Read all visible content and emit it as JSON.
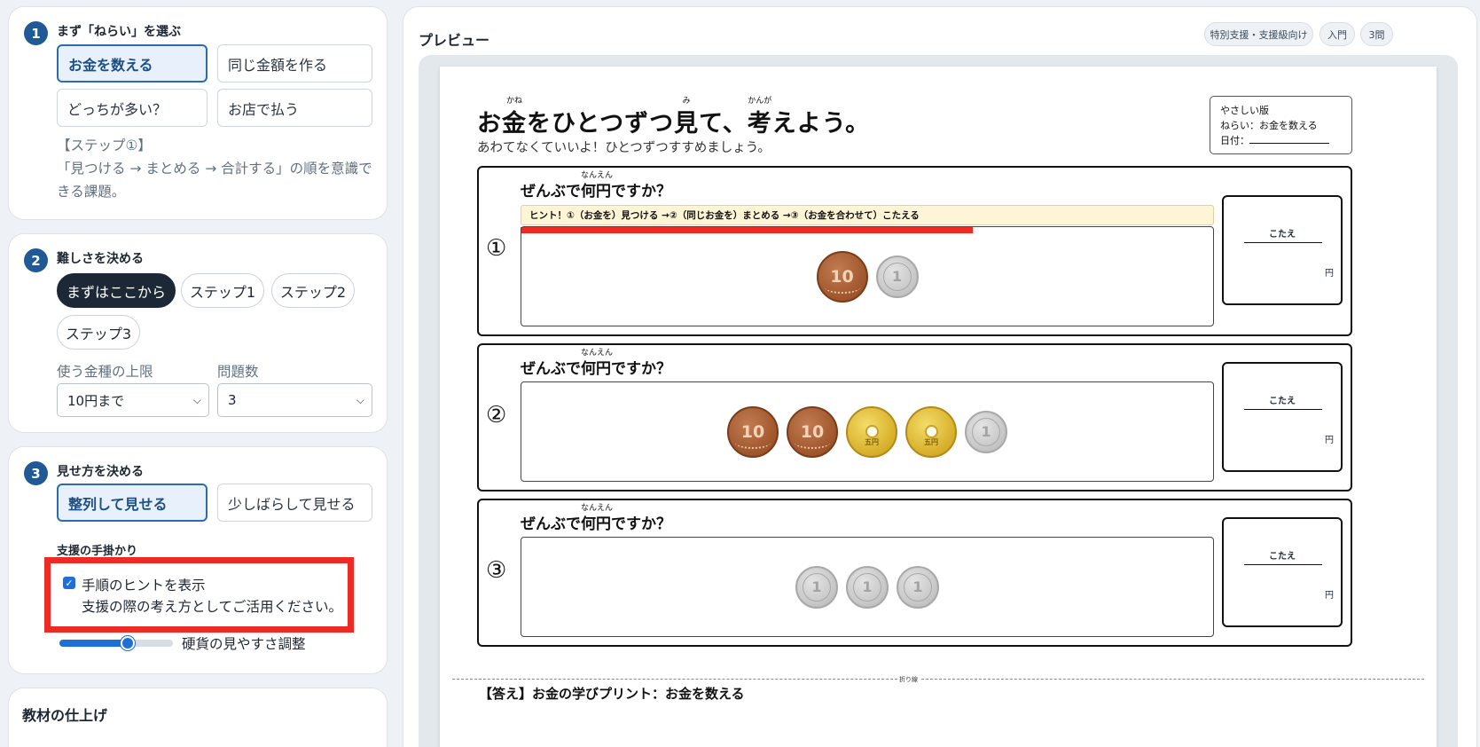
{
  "settings": {
    "step1": {
      "num": "1",
      "title": "まず「ねらい」を選ぶ",
      "options": [
        "お金を数える",
        "同じ金額を作る",
        "どっちが多い？",
        "お店で払う"
      ],
      "selected_index": 0,
      "note": "【ステップ①】\n「見つける → まとめる → 合計する」の順を意識できる課題。"
    },
    "step2": {
      "num": "2",
      "title": "難しさを決める",
      "levels": [
        "まずはここから",
        "ステップ1",
        "ステップ2",
        "ステップ3"
      ],
      "selected_index": 0,
      "coin_limit_label": "使う金種の上限",
      "coin_limit_value": "10円まで",
      "count_label": "問題数",
      "count_value": "3"
    },
    "step3": {
      "num": "3",
      "title": "見せ方を決める",
      "options": [
        "整列して見せる",
        "少しばらして見せる"
      ],
      "selected_index": 0,
      "support_title": "支援の手掛かり",
      "hint_checkbox_label": "手順のヒントを表示",
      "hint_checkbox_checked": true,
      "hint_checkbox_desc": "支援の際の考え方としてご活用ください。",
      "slider_label": "硬貨の見やすさ調整",
      "slider_value": 0.6
    },
    "finish": {
      "title": "教材の仕上げ"
    }
  },
  "preview": {
    "title": "プレビュー",
    "tags": [
      "特別支援・支援級向け",
      "入門",
      "3問"
    ],
    "sheet": {
      "title_parts": [
        {
          "t": "お"
        },
        {
          "t": "金",
          "r": "かね"
        },
        {
          "t": "をひとつずつ"
        },
        {
          "t": "見",
          "r": "み"
        },
        {
          "t": "て、"
        },
        {
          "t": "考",
          "r": "かんが"
        },
        {
          "t": "えよう。"
        }
      ],
      "subtitle": "あわてなくていいよ！ひとつずつすすめましょう。",
      "level_box": [
        "やさしい版",
        "ねらい：お金を数える",
        "日付："
      ],
      "hint_text": "ヒント！①（お金を）見つける →②（同じお金を）まとめる →③（お金を合わせて）こたえる",
      "question_text": "ぜんぶで何円ですか？",
      "question_ruby": "なんえん",
      "answer_label": "こたえ",
      "answer_unit": "円",
      "questions": [
        {
          "num": "①",
          "coins": [
            "10",
            "1"
          ]
        },
        {
          "num": "②",
          "coins": [
            "10",
            "10",
            "5",
            "5",
            "1"
          ]
        },
        {
          "num": "③",
          "coins": [
            "1",
            "1",
            "1"
          ]
        }
      ],
      "coin_labels": {
        "ten": "10",
        "one": "1",
        "five": "五円"
      },
      "fold_label": "折り線",
      "answer_section_title": "【答え】お金の学びプリント：お金を数える"
    }
  }
}
